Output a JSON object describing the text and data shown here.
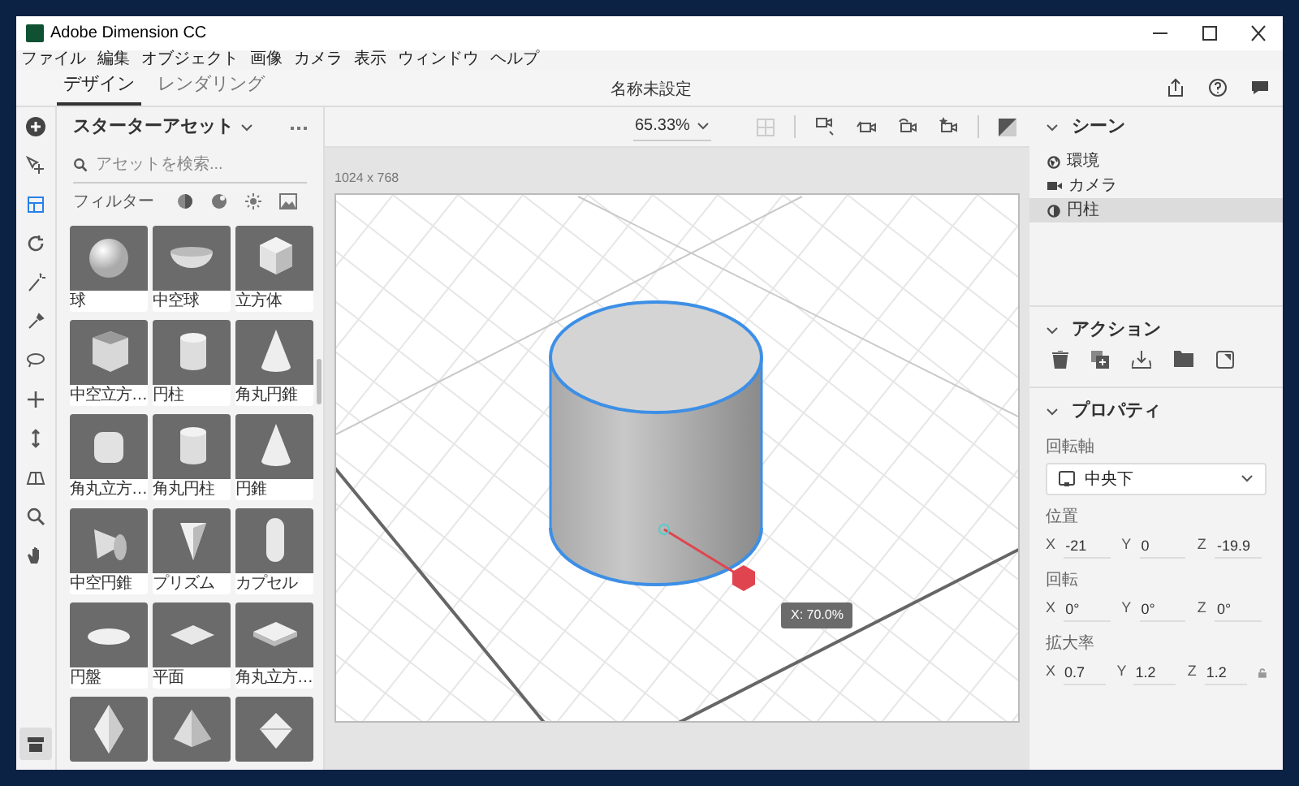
{
  "window": {
    "title": "Adobe Dimension CC"
  },
  "menu": [
    "ファイル",
    "編集",
    "オブジェクト",
    "画像",
    "カメラ",
    "表示",
    "ウィンドウ",
    "ヘルプ"
  ],
  "tabs": [
    {
      "label": "デザイン",
      "selected": true
    },
    {
      "label": "レンダリング",
      "selected": false
    }
  ],
  "document_title": "名称未設定",
  "assets_panel": {
    "title": "スターターアセット",
    "search": {
      "placeholder": "アセットを検索..."
    },
    "filter_label": "フィルター",
    "assets": [
      {
        "kind": "sphere",
        "label": "球"
      },
      {
        "kind": "bowl",
        "label": "中空球"
      },
      {
        "kind": "cube",
        "label": "立方体"
      },
      {
        "kind": "opencube",
        "label": "中空立方…"
      },
      {
        "kind": "cylinder",
        "label": "円柱"
      },
      {
        "kind": "cone",
        "label": "角丸円錐"
      },
      {
        "kind": "roundcube",
        "label": "角丸立方…"
      },
      {
        "kind": "cylinder",
        "label": "角丸円柱"
      },
      {
        "kind": "cone",
        "label": "円錐"
      },
      {
        "kind": "hollowcone",
        "label": "中空円錐"
      },
      {
        "kind": "prism",
        "label": "プリズム"
      },
      {
        "kind": "capsule",
        "label": "カプセル"
      },
      {
        "kind": "disc",
        "label": "円盤"
      },
      {
        "kind": "plane",
        "label": "平面"
      },
      {
        "kind": "slab",
        "label": "角丸立方…"
      },
      {
        "kind": "diamond"
      },
      {
        "kind": "pyramid"
      },
      {
        "kind": "octa"
      }
    ]
  },
  "viewport": {
    "zoom": "65.33%",
    "canvas_size": "1024 x 768",
    "tooltip": "X: 70.0%"
  },
  "scene": {
    "title": "シーン",
    "expanded": true,
    "items": [
      {
        "kind": "environment",
        "label": "環境",
        "selected": false
      },
      {
        "kind": "camera",
        "label": "カメラ",
        "selected": false
      },
      {
        "kind": "model",
        "label": "円柱",
        "selected": true
      }
    ]
  },
  "actions": {
    "title": "アクション",
    "expanded": true
  },
  "properties": {
    "title": "プロパティ",
    "expanded": true,
    "pivot_label": "回転軸",
    "pivot_value": "中央下",
    "groups": [
      {
        "label": "位置",
        "fields": [
          {
            "axis": "X",
            "value": "-21"
          },
          {
            "axis": "Y",
            "value": "0"
          },
          {
            "axis": "Z",
            "value": "-19.9"
          }
        ]
      },
      {
        "label": "回転",
        "fields": [
          {
            "axis": "X",
            "value": "0°"
          },
          {
            "axis": "Y",
            "value": "0°"
          },
          {
            "axis": "Z",
            "value": "0°"
          }
        ]
      },
      {
        "label": "拡大率",
        "locked": false,
        "fields": [
          {
            "axis": "X",
            "value": "0.7"
          },
          {
            "axis": "Y",
            "value": "1.2"
          },
          {
            "axis": "Z",
            "value": "1.2"
          }
        ]
      }
    ]
  }
}
